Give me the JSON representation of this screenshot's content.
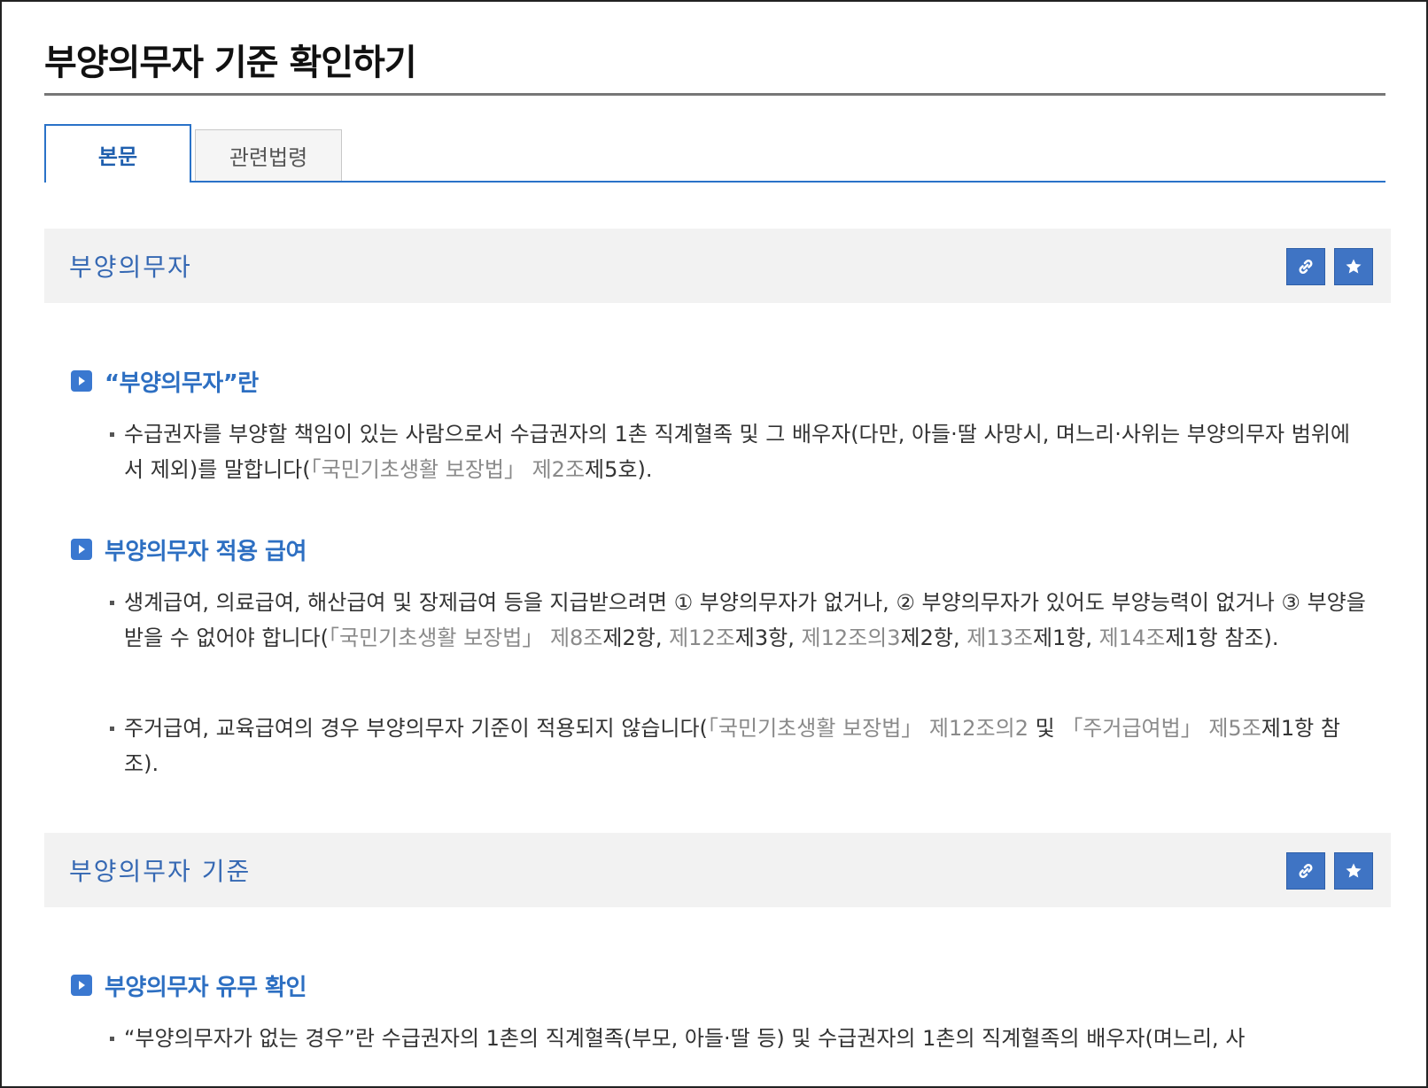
{
  "page": {
    "title": "부양의무자 기준 확인하기"
  },
  "tabs": [
    {
      "label": "본문",
      "active": true
    },
    {
      "label": "관련법령",
      "active": false
    }
  ],
  "colors": {
    "accent": "#2a72c8",
    "heading": "#2d6fc2",
    "reference": "#8a8a8a",
    "section_bar": "#f2f2f2"
  },
  "sections": [
    {
      "title": "부양의무자",
      "link_icon": "link-icon",
      "star_icon": "star-icon",
      "subsections": [
        {
          "heading": "“부양의무자”란",
          "bullets": [
            {
              "p1": "수급권자를 부양할 책임이 있는 사람으로서 수급권자의 1촌 직계혈족 및 그 배우자(다만, 아들·딸 사망시, 며느리·사위는 부양의무자 범위에서 제외)를 말합니다(",
              "r1": "「국민기초생활 보장법」 제2조",
              "p2": "제5호)."
            }
          ]
        },
        {
          "heading": "부양의무자 적용 급여",
          "bullets": [
            {
              "p1": "생계급여, 의료급여, 해산급여 및 장제급여 등을 지급받으려면 ① 부양의무자가 없거나, ② 부양의무자가 있어도 부양능력이 없거나 ③ 부양을 받을 수 없어야 합니다(",
              "r1": "「국민기초생활 보장법」 제8조",
              "p2": "제2항, ",
              "r2": "제12조",
              "p3": "제3항, ",
              "r3": "제12조의3",
              "p4": "제2항, ",
              "r4": "제13조",
              "p5": "제1항, ",
              "r5": "제14조",
              "p6": "제1항 참조)."
            },
            {
              "p1": "주거급여, 교육급여의 경우 부양의무자 기준이 적용되지 않습니다(",
              "r1": "「국민기초생활 보장법」 제12조의2",
              "p2": " 및 ",
              "r2": "「주거급여법」 제5조",
              "p3": "제1항 참조)."
            }
          ]
        }
      ]
    },
    {
      "title": "부양의무자 기준",
      "link_icon": "link-icon",
      "star_icon": "star-icon",
      "subsections": [
        {
          "heading": "부양의무자 유무 확인",
          "bullets": [
            {
              "p1": "“부양의무자가 없는 경우”란 수급권자의 1촌의 직계혈족(부모, 아들·딸 등) 및 수급권자의 1촌의 직계혈족의 배우자(며느리, 사"
            }
          ]
        }
      ]
    }
  ]
}
